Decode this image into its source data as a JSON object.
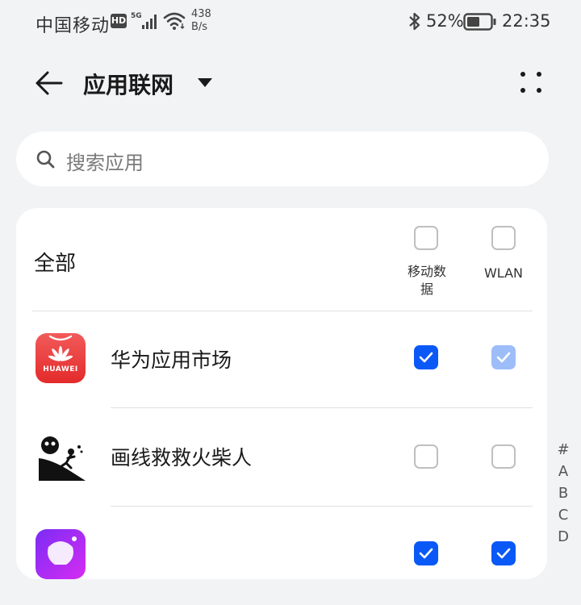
{
  "status_bar": {
    "carrier": "中国移动",
    "hd_badge": "HD",
    "signal_type": "5G",
    "net_speed_value": "438",
    "net_speed_unit": "B/s",
    "battery_percent": "52%",
    "time": "22:35",
    "icons": [
      "signal-icon",
      "wifi-icon",
      "bluetooth-icon",
      "battery-icon"
    ]
  },
  "header": {
    "title": "应用联网",
    "icons": [
      "back-arrow-icon",
      "dropdown-triangle-icon",
      "more-dots-icon"
    ]
  },
  "search": {
    "placeholder": "搜索应用",
    "icon": "search-icon"
  },
  "list": {
    "all_label": "全部",
    "columns": {
      "mobile_data": "移动数据",
      "wlan": "WLAN"
    },
    "header_checks": {
      "mobile_data": false,
      "wlan": false
    },
    "apps": [
      {
        "name": "华为应用市场",
        "icon_text": "HUAWEI",
        "icon": "huawei-appgallery-icon",
        "mobile_data": true,
        "wlan": true,
        "wlan_dimmed": true
      },
      {
        "name": "画线救救火柴人",
        "icon": "stickman-game-icon",
        "mobile_data": false,
        "wlan": false
      },
      {
        "name": "",
        "icon": "purple-app-icon",
        "mobile_data": true,
        "wlan": true
      }
    ]
  },
  "index_bar": {
    "letters": [
      "#",
      "A",
      "B",
      "C",
      "D"
    ]
  },
  "colors": {
    "background": "#f1f3f5",
    "accent": "#0a59f7",
    "accent_dimmed": "#9dbdf8",
    "huawei_red": "#e32a2a"
  }
}
